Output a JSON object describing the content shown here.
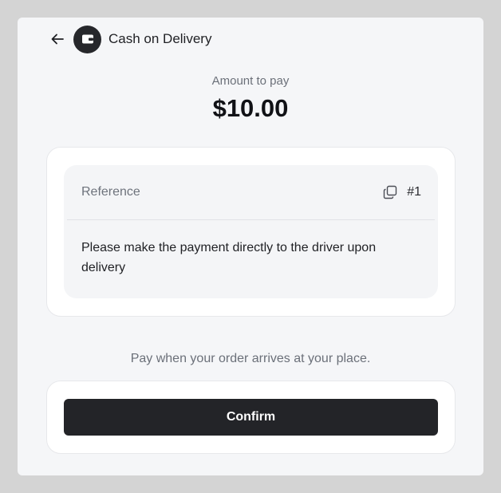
{
  "header": {
    "back_icon": "arrow-left-icon",
    "method_icon": "wallet-icon",
    "title": "Cash on Delivery"
  },
  "amount": {
    "label": "Amount to pay",
    "value": "$10.00"
  },
  "reference": {
    "label": "Reference",
    "copy_icon": "copy-icon",
    "number": "#1",
    "instruction": "Please make the payment directly to the driver upon delivery"
  },
  "note": "Pay when your order arrives at your place.",
  "confirm": {
    "label": "Confirm"
  },
  "colors": {
    "accent_dark": "#232428",
    "panel_bg": "#f5f6f8",
    "muted_text": "#6b7079"
  }
}
